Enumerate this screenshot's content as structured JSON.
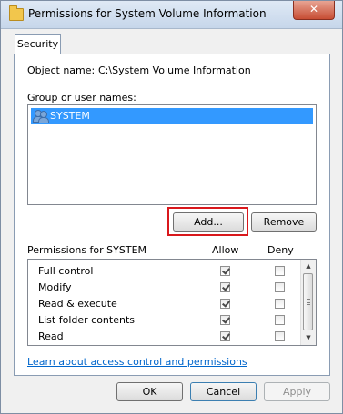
{
  "window": {
    "title": "Permissions for System Volume Information",
    "close_glyph": "✕"
  },
  "tabs": [
    {
      "label": "Security"
    }
  ],
  "object": {
    "label": "Object name:",
    "value": "C:\\System Volume Information"
  },
  "groups": {
    "label": "Group or user names:",
    "items": [
      {
        "name": "SYSTEM",
        "icon": "users-icon",
        "selected": true
      }
    ]
  },
  "buttons": {
    "add": "Add...",
    "remove": "Remove",
    "ok": "OK",
    "cancel": "Cancel",
    "apply": "Apply"
  },
  "permissions": {
    "label": "Permissions for SYSTEM",
    "allow_header": "Allow",
    "deny_header": "Deny",
    "rows": [
      {
        "name": "Full control",
        "allow": true,
        "deny": false
      },
      {
        "name": "Modify",
        "allow": true,
        "deny": false
      },
      {
        "name": "Read & execute",
        "allow": true,
        "deny": false
      },
      {
        "name": "List folder contents",
        "allow": true,
        "deny": false
      },
      {
        "name": "Read",
        "allow": true,
        "deny": false
      }
    ]
  },
  "link": "Learn about access control and permissions",
  "colors": {
    "selection": "#3399ff",
    "highlight_box": "#d9181c",
    "link": "#0066cc"
  }
}
